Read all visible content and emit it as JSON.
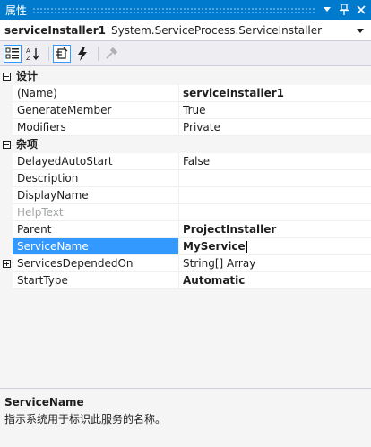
{
  "window": {
    "title": "属性"
  },
  "selector": {
    "object_name": "serviceInstaller1",
    "object_type": "System.ServiceProcess.ServiceInstaller"
  },
  "toolbar": {
    "buttons": [
      "categorized-icon",
      "alphabetical-icon",
      "properties-icon",
      "events-icon",
      "property-pages-icon"
    ]
  },
  "categories": [
    {
      "label": "设计"
    },
    {
      "label": "杂项"
    }
  ],
  "properties": [
    {
      "name": "(Name)",
      "value": "serviceInstaller1"
    },
    {
      "name": "GenerateMember",
      "value": "True"
    },
    {
      "name": "Modifiers",
      "value": "Private"
    },
    {
      "name": "DelayedAutoStart",
      "value": "False"
    },
    {
      "name": "Description",
      "value": ""
    },
    {
      "name": "DisplayName",
      "value": ""
    },
    {
      "name": "HelpText",
      "value": ""
    },
    {
      "name": "Parent",
      "value": "ProjectInstaller"
    },
    {
      "name": "ServiceName",
      "value": "MyService"
    },
    {
      "name": "ServicesDependedOn",
      "value": "String[] Array"
    },
    {
      "name": "StartType",
      "value": "Automatic"
    }
  ],
  "description": {
    "title": "ServiceName",
    "text": "指示系统用于标识此服务的名称。"
  },
  "colors": {
    "titlebar": "#007acc",
    "selection": "#3399ff",
    "background": "#f5f5f5"
  }
}
